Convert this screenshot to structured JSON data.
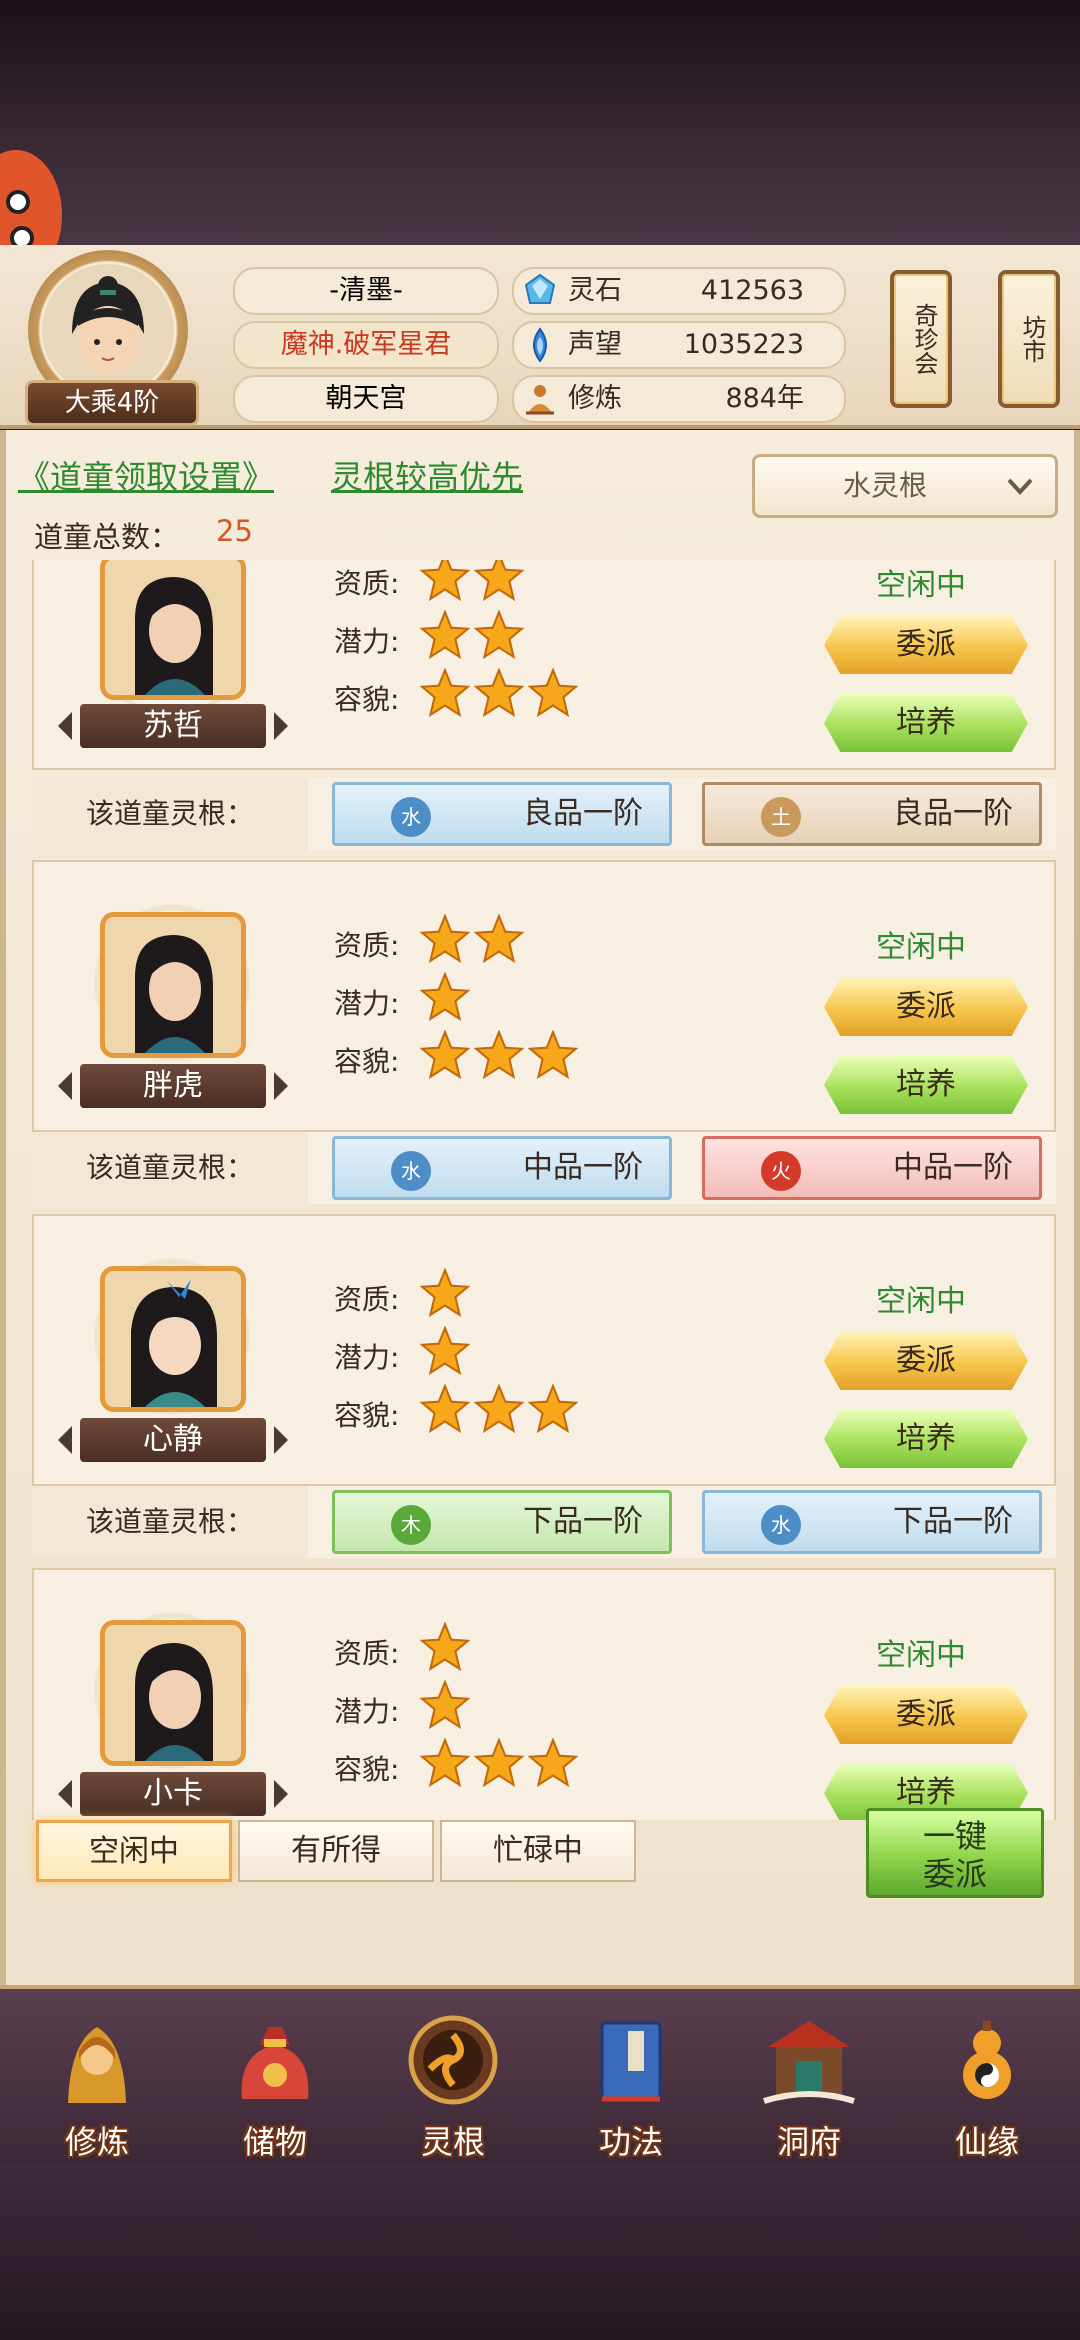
{
  "player": {
    "name": "-清墨-",
    "title": "魔神.破军星君",
    "sect": "朝天宫",
    "realm": "大乘4阶"
  },
  "resources": [
    {
      "icon": "spirit-stone-icon",
      "label": "灵石",
      "value": "412563"
    },
    {
      "icon": "reputation-icon",
      "label": "声望",
      "value": "1035223"
    },
    {
      "icon": "cultivation-icon",
      "label": "修炼",
      "value": "884年"
    }
  ],
  "side_buttons": {
    "treasure": "奇珍会",
    "market": "坊市"
  },
  "settings": {
    "receive_settings_link": "《道童领取设置》",
    "priority_link": "灵根较高优先",
    "root_filter": "水灵根",
    "total_label": "道童总数：",
    "total_value": "25"
  },
  "attr_labels": {
    "aptitude": "资质:",
    "potential": "潜力:",
    "appearance": "容貌:"
  },
  "root_row_label": "该道童灵根：",
  "buttons": {
    "dispatch": "委派",
    "train": "培养"
  },
  "apprentices": [
    {
      "name": "苏哲",
      "status": "空闲中",
      "aptitude": 2,
      "potential": 2,
      "appearance": 3,
      "roots": [
        {
          "element": "水",
          "kind": "water",
          "grade": "良品一阶"
        },
        {
          "element": "土",
          "kind": "earth",
          "grade": "良品一阶"
        }
      ]
    },
    {
      "name": "胖虎",
      "status": "空闲中",
      "aptitude": 2,
      "potential": 1,
      "appearance": 3,
      "roots": [
        {
          "element": "水",
          "kind": "water",
          "grade": "中品一阶"
        },
        {
          "element": "火",
          "kind": "fire",
          "grade": "中品一阶"
        }
      ]
    },
    {
      "name": "心静",
      "status": "空闲中",
      "aptitude": 1,
      "potential": 1,
      "appearance": 3,
      "roots": [
        {
          "element": "木",
          "kind": "wood",
          "grade": "下品一阶"
        },
        {
          "element": "水",
          "kind": "water",
          "grade": "下品一阶"
        }
      ]
    },
    {
      "name": "小卡",
      "status": "空闲中",
      "aptitude": 1,
      "potential": 1,
      "appearance": 3,
      "roots": []
    }
  ],
  "filter_tabs": [
    "空闲中",
    "有所得",
    "忙碌中"
  ],
  "active_tab": "空闲中",
  "one_key_dispatch": {
    "line1": "一键",
    "line2": "委派"
  },
  "bottom_nav": [
    {
      "label": "修炼",
      "icon": "monk-icon"
    },
    {
      "label": "储物",
      "icon": "bag-icon"
    },
    {
      "label": "灵根",
      "icon": "spirit-root-icon"
    },
    {
      "label": "功法",
      "icon": "book-icon"
    },
    {
      "label": "洞府",
      "icon": "cave-house-icon"
    },
    {
      "label": "仙缘",
      "icon": "gourd-icon"
    }
  ]
}
